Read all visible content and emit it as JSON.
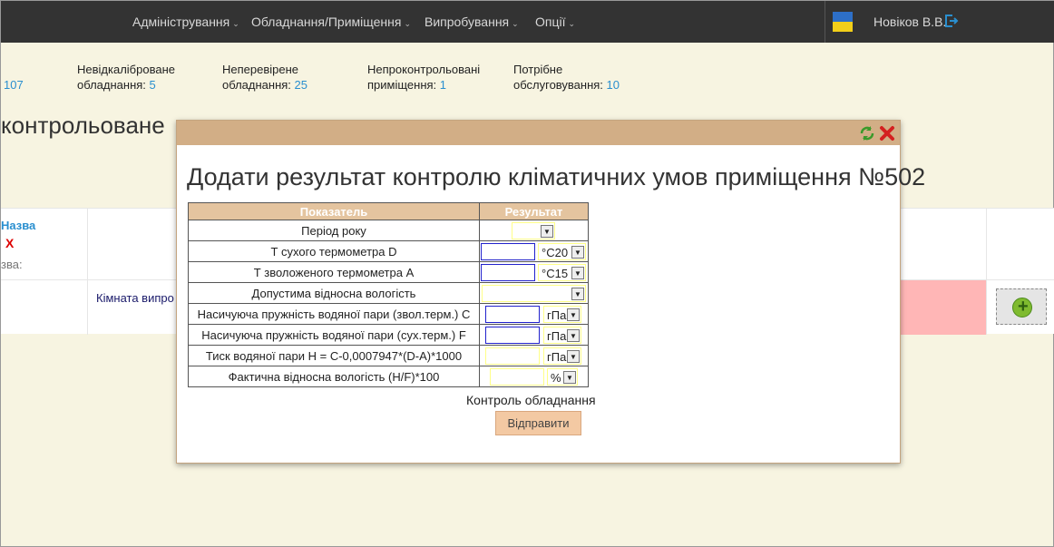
{
  "nav": {
    "items": [
      "Адміністрування",
      "Обладнання/Приміщення",
      "Випробування",
      "Опції"
    ],
    "user": "Новіков В.В."
  },
  "stats": {
    "first_num": "107",
    "items": [
      {
        "label1": "Невідкаліброване",
        "label2": "обладнання:",
        "value": "5"
      },
      {
        "label1": "Неперевірене",
        "label2": "обладнання:",
        "value": "25"
      },
      {
        "label1": "Непроконтрольовані",
        "label2": "приміщення:",
        "value": "1"
      },
      {
        "label1": "Потрібне",
        "label2": "обслуговування:",
        "value": "10"
      }
    ]
  },
  "page_title": "контрольоване",
  "table": {
    "name_header": "Назва",
    "x_mark": "X",
    "sub_label": "зва:",
    "room_link": "Кімната випро"
  },
  "modal": {
    "title": "Додати результат контролю кліматичних умов приміщення №502",
    "col_param": "Показатель",
    "col_result": "Результат",
    "rows": [
      {
        "label": "Період року"
      },
      {
        "label": "Т сухого термометра D",
        "unit": "°C20"
      },
      {
        "label": "Т зволоженого термометра А",
        "unit": "°C15"
      },
      {
        "label": "Допустима відносна вологість"
      },
      {
        "label": "Насичуюча пружність водяної пари (звол.терм.) С",
        "unit": "гПа"
      },
      {
        "label": "Насичуюча пружність водяної пари (сух.терм.) F",
        "unit": "гПа"
      },
      {
        "label": "Тиск водяної пари Н = С-0,0007947*(D-A)*1000",
        "unit": "гПа"
      },
      {
        "label": "Фактична відносна вологість (H/F)*100",
        "unit": "%"
      }
    ],
    "control_label": "Контроль обладнання",
    "submit_label": "Відправити"
  },
  "colors": {
    "navbar": "#333333",
    "accent": "#2a8fcf",
    "modal_header": "#d2ae86",
    "alert_row": "#ffb6b6"
  }
}
